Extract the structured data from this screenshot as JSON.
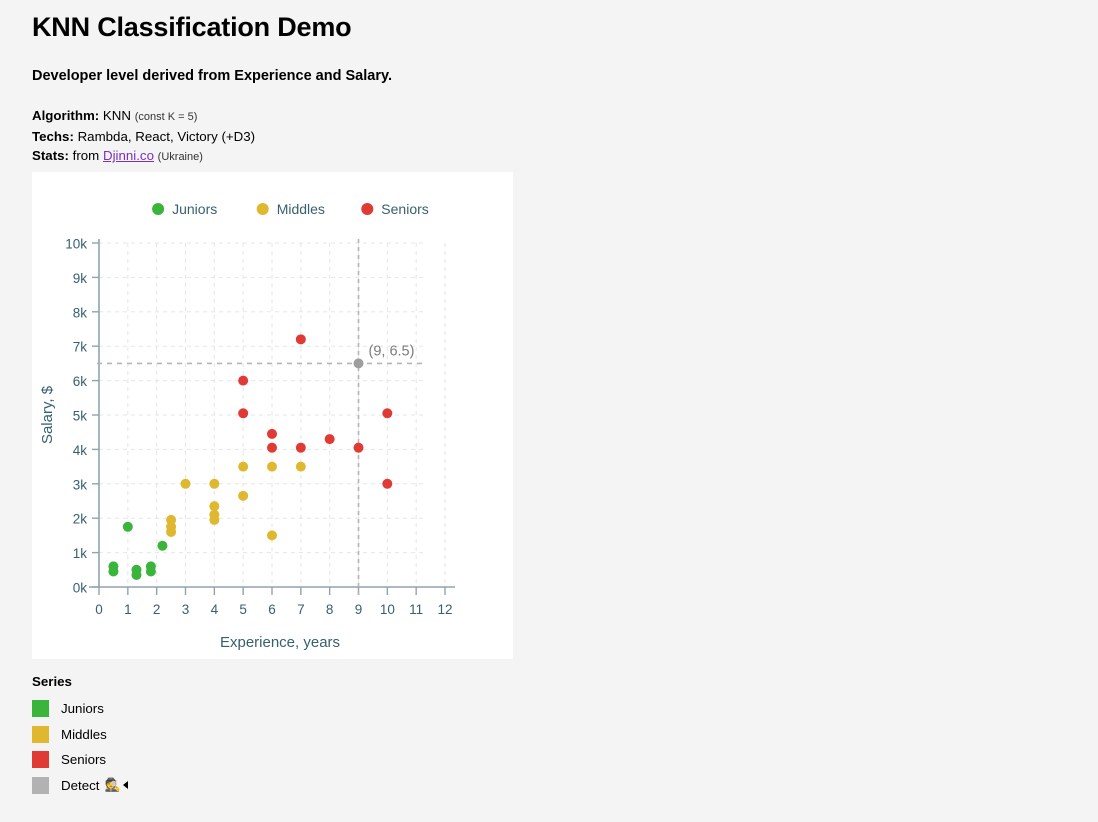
{
  "header": {
    "title": "KNN Classification Demo",
    "subtitle": "Developer level derived from Experience and Salary.",
    "meta": {
      "algorithm_key": "Algorithm:",
      "algorithm_value": "KNN",
      "algorithm_note": "(const K = 5)",
      "techs_key": "Techs:",
      "techs_value": "Rambda, React, Victory (+D3)",
      "stats_key": "Stats:",
      "stats_prefix": "from",
      "stats_link": "Djinni.co",
      "stats_note": "(Ukraine)"
    }
  },
  "series_panel": {
    "heading": "Series",
    "items": [
      {
        "label": "Juniors",
        "color": "#3BB43B"
      },
      {
        "label": "Middles",
        "color": "#E0B82F"
      },
      {
        "label": "Seniors",
        "color": "#E03A35"
      },
      {
        "label": "Detect",
        "color": "#B2B2B2",
        "emoji": "🕵"
      }
    ]
  },
  "chart_data": {
    "type": "scatter",
    "title": "",
    "xlabel": "Experience, years",
    "ylabel": "Salary, $",
    "xlim": [
      0,
      12
    ],
    "ylim": [
      0,
      10
    ],
    "xticks": [
      0,
      1,
      2,
      3,
      4,
      5,
      6,
      7,
      8,
      9,
      10,
      11,
      12
    ],
    "xticklabels": [
      "0",
      "1",
      "2",
      "3",
      "4",
      "5",
      "6",
      "7",
      "8",
      "9",
      "10",
      "11",
      "12"
    ],
    "yticks": [
      0,
      1,
      2,
      3,
      4,
      5,
      6,
      7,
      8,
      9,
      10
    ],
    "yticklabels": [
      "0k",
      "1k",
      "2k",
      "3k",
      "4k",
      "5k",
      "6k",
      "7k",
      "8k",
      "9k",
      "10k"
    ],
    "grid": true,
    "legend_position": "top",
    "legend": [
      {
        "name": "Juniors",
        "color": "#3BB43B"
      },
      {
        "name": "Middles",
        "color": "#E0B82F"
      },
      {
        "name": "Seniors",
        "color": "#E03A35"
      }
    ],
    "series": [
      {
        "name": "Juniors",
        "color": "#3BB43B",
        "points": [
          [
            0.5,
            0.6
          ],
          [
            0.5,
            0.45
          ],
          [
            1.0,
            1.75
          ],
          [
            1.3,
            0.5
          ],
          [
            1.3,
            0.35
          ],
          [
            1.8,
            0.6
          ],
          [
            1.8,
            0.45
          ],
          [
            2.2,
            1.2
          ]
        ]
      },
      {
        "name": "Middles",
        "color": "#E0B82F",
        "points": [
          [
            2.5,
            1.95
          ],
          [
            2.5,
            1.6
          ],
          [
            2.5,
            1.75
          ],
          [
            3.0,
            3.0
          ],
          [
            4.0,
            3.0
          ],
          [
            4.0,
            2.35
          ],
          [
            4.0,
            2.1
          ],
          [
            4.0,
            1.95
          ],
          [
            5.0,
            3.5
          ],
          [
            5.0,
            2.65
          ],
          [
            6.0,
            3.5
          ],
          [
            6.0,
            1.5
          ],
          [
            7.0,
            3.5
          ]
        ]
      },
      {
        "name": "Seniors",
        "color": "#E03A35",
        "points": [
          [
            5.0,
            6.0
          ],
          [
            5.0,
            5.05
          ],
          [
            6.0,
            4.45
          ],
          [
            6.0,
            4.05
          ],
          [
            7.0,
            7.2
          ],
          [
            7.0,
            4.05
          ],
          [
            8.0,
            4.3
          ],
          [
            9.0,
            4.05
          ],
          [
            10.0,
            5.05
          ],
          [
            10.0,
            3.0
          ]
        ]
      }
    ],
    "detect_marker": {
      "x": 9,
      "y": 6.5,
      "label": "(9, 6.5)",
      "color": "#9E9E9E"
    }
  }
}
